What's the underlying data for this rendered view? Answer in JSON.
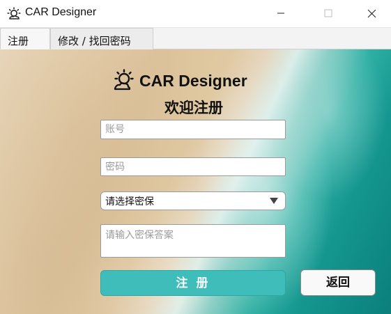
{
  "window": {
    "title": "CAR Designer",
    "app_icon": "sun-cloud-icon",
    "controls": [
      "minimize-icon",
      "maximize-icon",
      "close-icon"
    ]
  },
  "tabs": [
    {
      "label": "注册",
      "active": true
    },
    {
      "label": "修改 / 找回密码",
      "active": false
    }
  ],
  "header": {
    "logo_icon": "sun-cloud-icon",
    "brand": "CAR Designer",
    "welcome": "欢迎注册"
  },
  "form": {
    "account_placeholder": "账号",
    "account_value": "",
    "password_placeholder": "密码",
    "password_value": "",
    "security_question": "请选择密保",
    "answer_placeholder": "请输入密保答案",
    "answer_value": ""
  },
  "buttons": {
    "register": "注 册",
    "back": "返回"
  },
  "colors": {
    "primary_button": "#3fbdba",
    "secondary_button": "#f9f9f9"
  }
}
